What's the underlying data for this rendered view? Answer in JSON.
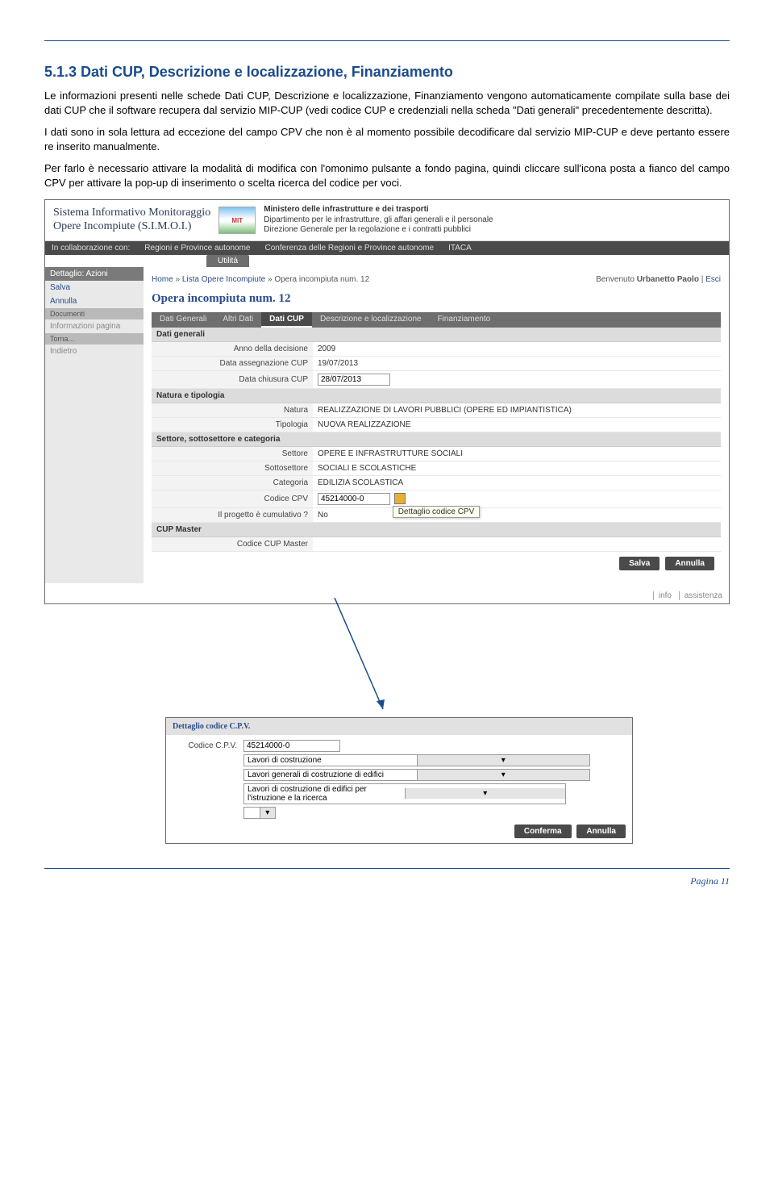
{
  "doc": {
    "heading": "5.1.3 Dati CUP, Descrizione e localizzazione, Finanziamento",
    "p1": "Le informazioni presenti nelle schede Dati CUP, Descrizione e localizzazione, Finanziamento vengono automaticamente compilate sulla base dei dati CUP che il software recupera dal servizio MIP-CUP (vedi codice CUP e credenziali nella scheda \"Dati generali\" precedentemente descritta).",
    "p2": "I dati sono in sola lettura ad eccezione del campo CPV che non è al momento possibile decodificare dal servizio MIP-CUP e deve pertanto essere re inserito manualmente.",
    "p3": "Per farlo è necessario attivare la modalità di modifica con l'omonimo pulsante a fondo pagina, quindi cliccare sull'icona posta a fianco del campo CPV per attivare la pop-up di inserimento o scelta ricerca del codice per voci.",
    "pagenum": "Pagina 11"
  },
  "app": {
    "title1": "Sistema Informativo Monitoraggio",
    "title2": "Opere Incompiute (S.I.M.O.I.)",
    "logo_label": "MIT",
    "min_title": "Ministero delle infrastrutture e dei trasporti",
    "min_sub1": "Dipartimento per le infrastrutture, gli affari generali e il personale",
    "min_sub2": "Direzione Generale per la regolazione e i contratti pubblici",
    "collab": "In collaborazione con:",
    "collab1": "Regioni e Province autonome",
    "collab2": "Conferenza delle Regioni e Province autonome",
    "collab3": "ITACA",
    "util": "Utilità"
  },
  "sidebar": {
    "head1": "Dettaglio: Azioni",
    "salva": "Salva",
    "annulla": "Annulla",
    "head2": "Documenti",
    "info_pagina": "Informazioni pagina",
    "head3": "Torna...",
    "indietro": "Indietro"
  },
  "main": {
    "crumb_home": "Home",
    "crumb_sep": " » ",
    "crumb_lista": "Lista Opere Incompiute",
    "crumb_opera": "Opera incompiuta num. 12",
    "welcome": "Benvenuto ",
    "user": "Urbanetto Paolo",
    "esci": "Esci",
    "page_title": "Opera incompiuta num. 12"
  },
  "tabs": {
    "t1": "Dati Generali",
    "t2": "Altri Dati",
    "t3": "Dati CUP",
    "t4": "Descrizione e localizzazione",
    "t5": "Finanziamento"
  },
  "form": {
    "sec1": "Dati generali",
    "l_anno": "Anno della decisione",
    "v_anno": "2009",
    "l_data_assegn": "Data assegnazione CUP",
    "v_data_assegn": "19/07/2013",
    "l_data_chiusura": "Data chiusura CUP",
    "v_data_chiusura": "28/07/2013",
    "sec2": "Natura e tipologia",
    "l_natura": "Natura",
    "v_natura": "REALIZZAZIONE DI LAVORI PUBBLICI (OPERE ED IMPIANTISTICA)",
    "l_tipologia": "Tipologia",
    "v_tipologia": "NUOVA REALIZZAZIONE",
    "sec3": "Settore, sottosettore e categoria",
    "l_settore": "Settore",
    "v_settore": "OPERE E INFRASTRUTTURE SOCIALI",
    "l_sottosettore": "Sottosettore",
    "v_sottosettore": "SOCIALI E SCOLASTICHE",
    "l_categoria": "Categoria",
    "v_categoria": "EDILIZIA SCOLASTICA",
    "l_cpv": "Codice CPV",
    "v_cpv": "45214000-0",
    "tooltip": "Dettaglio codice CPV",
    "l_cumul": "Il progetto è cumulativo ?",
    "v_cumul": "No",
    "sec4": "CUP Master",
    "l_cup_master": "Codice CUP Master",
    "btn_salva": "Salva",
    "btn_annulla": "Annulla"
  },
  "footer": {
    "info": "info",
    "assist": "assistenza"
  },
  "popup": {
    "title": "Dettaglio codice C.P.V.",
    "l_code": "Codice C.P.V.",
    "v_code": "45214000-0",
    "sel1": "Lavori di costruzione",
    "sel2": "Lavori generali di costruzione di edifici",
    "sel3": "Lavori di costruzione di edifici per l'istruzione e la ricerca",
    "btn_conf": "Conferma",
    "btn_ann": "Annulla"
  }
}
